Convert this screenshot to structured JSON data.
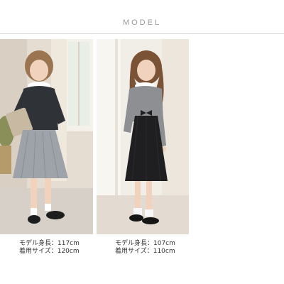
{
  "section": {
    "title": "MODEL"
  },
  "models": [
    {
      "height_line": "モデル身長：117cm",
      "size_line": "着用サイズ：120cm",
      "outfit": "navy bolero jacket with grey pleated dress"
    },
    {
      "height_line": "モデル身長：107cm",
      "size_line": "着用サイズ：110cm",
      "outfit": "grey bolero with black dress"
    }
  ],
  "colors": {
    "rule": "#d9d9d9",
    "title": "#9a9a9a",
    "caption": "#333333"
  }
}
